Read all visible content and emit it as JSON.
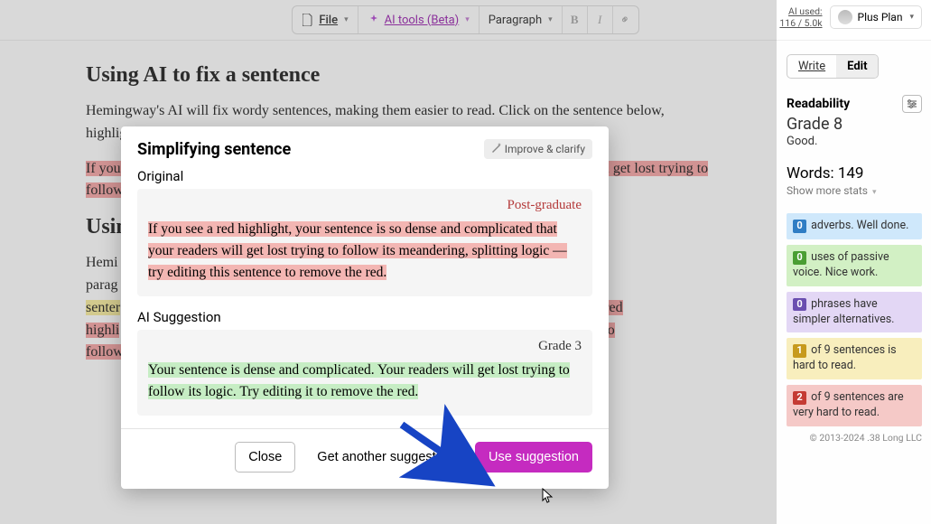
{
  "toolbar": {
    "file_label": "File",
    "ai_label": "AI tools (Beta)",
    "paragraph_label": "Paragraph"
  },
  "header_right": {
    "ai_used_label": "AI used:",
    "ai_used_value": "116 / 5.0k",
    "plan_label": "Plus Plan"
  },
  "editor": {
    "h1": "Using AI to fix a sentence",
    "p1": "Hemingway's AI will fix wordy sentences, making them easier to read. Click on the sentence below, highlighted in red, and choose 'Fix it for me'.",
    "red_sentence": "If you see a red highlight, your sentence is so dense and complicated that your readers will get lost trying to follow its meandering, splitting logic — try editing this sentence to remove the red.",
    "h2": "Using",
    "p2a": "Hemi",
    "p2b": "parag",
    "yellow_part": "senter",
    "red_part_a": "red",
    "red_part_b": "highli",
    "red_part_c": "to",
    "tail": "follow"
  },
  "sidebar": {
    "write": "Write",
    "edit": "Edit",
    "readability_label": "Readability",
    "grade": "Grade 8",
    "quality": "Good.",
    "words_label": "Words:",
    "words_value": "149",
    "show_more": "Show more stats",
    "rows": [
      {
        "count": "0",
        "text": "adverbs. Well done."
      },
      {
        "count": "0",
        "text": "uses of passive voice. Nice work."
      },
      {
        "count": "0",
        "text": "phrases have simpler alternatives."
      },
      {
        "count": "1",
        "text": "of 9 sentences is hard to read."
      },
      {
        "count": "2",
        "text": "of 9 sentences are very hard to read."
      }
    ],
    "copyright": "© 2013-2024 .38 Long LLC"
  },
  "modal": {
    "title": "Simplifying sentence",
    "improve_label": "Improve & clarify",
    "original_label": "Original",
    "original_grade": "Post-graduate",
    "original_text": "If you see a red highlight, your sentence is so dense and complicated that your readers will get lost trying to follow its meandering, splitting logic — try editing this sentence to remove the red.",
    "suggestion_label": "AI Suggestion",
    "suggestion_grade": "Grade 3",
    "suggestion_text": "Your sentence is dense and complicated. Your readers will get lost trying to follow its logic. Try editing it to remove the red.",
    "close": "Close",
    "another": "Get another suggestion",
    "use": "Use suggestion"
  }
}
